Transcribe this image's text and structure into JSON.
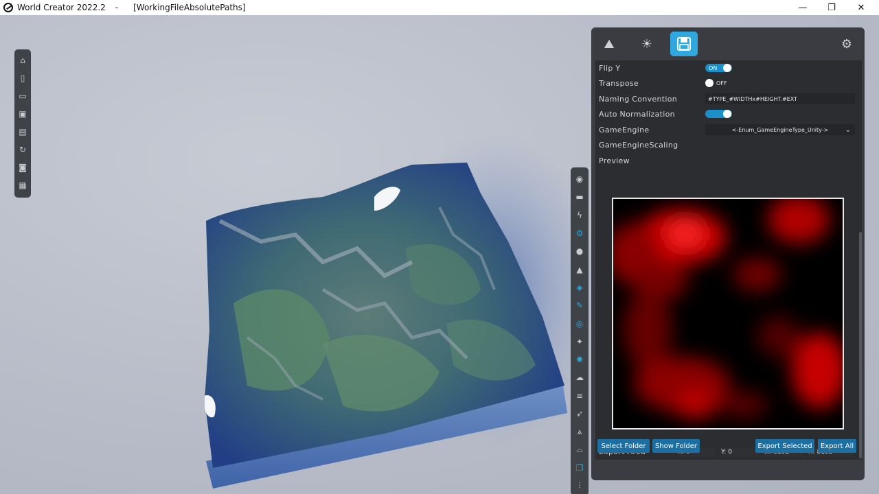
{
  "window": {
    "app_title": "World Creator 2022.2",
    "separator": "-",
    "file": "[WorkingFileAbsolutePaths]",
    "minimize": "—",
    "maximize": "❐",
    "close": "✕"
  },
  "left_toolbar": {
    "icons": [
      "home-icon",
      "new-file-icon",
      "open-folder-icon",
      "save-icon",
      "save-as-icon",
      "refresh-icon",
      "camera-icon",
      "export-icon"
    ]
  },
  "right_toolbar": {
    "icons": [
      "target-icon",
      "folder-icon",
      "lightning-icon",
      "gears-icon",
      "drop-icon",
      "mountain-icon",
      "layers-icon",
      "brush-icon",
      "eye-icon",
      "sparkle-icon",
      "sun-icon",
      "cloud-icon",
      "waves-icon",
      "rocket-icon",
      "terrain-icon",
      "bridge-icon",
      "stack-icon",
      "chart-icon"
    ]
  },
  "panel": {
    "tabs": [
      {
        "name": "terrain-tab",
        "glyph": "⛰"
      },
      {
        "name": "light-tab",
        "glyph": "☀"
      },
      {
        "name": "export-tab",
        "glyph": "💾"
      }
    ],
    "settings_glyph": "⚙",
    "flip_y": {
      "label": "Flip Y",
      "state": "ON"
    },
    "transpose": {
      "label": "Transpose",
      "state": "OFF"
    },
    "naming": {
      "label": "Naming Convention",
      "value": "#TYPE_#WIDTHx#HEIGHT.#EXT"
    },
    "auto_norm": {
      "label": "Auto Normalization"
    },
    "game_engine": {
      "label": "GameEngine",
      "value": "<-Enum_GameEngineType_Unity->"
    },
    "game_engine_scaling": {
      "label": "GameEngineScaling"
    },
    "preview": {
      "label": "Preview"
    },
    "export_area": {
      "label": "Export Area",
      "x": "X: 0",
      "y": "Y: 0",
      "w": "W: 8192",
      "h": "H: 8192"
    },
    "buttons": {
      "select_folder": "Select Folder",
      "show_folder": "Show Folder",
      "export_selected": "Export Selected",
      "export_all": "Export All"
    }
  },
  "colors": {
    "accent": "#2ea8df",
    "panel_bg": "#3a3c41",
    "button_bg": "#1c6fa3"
  }
}
